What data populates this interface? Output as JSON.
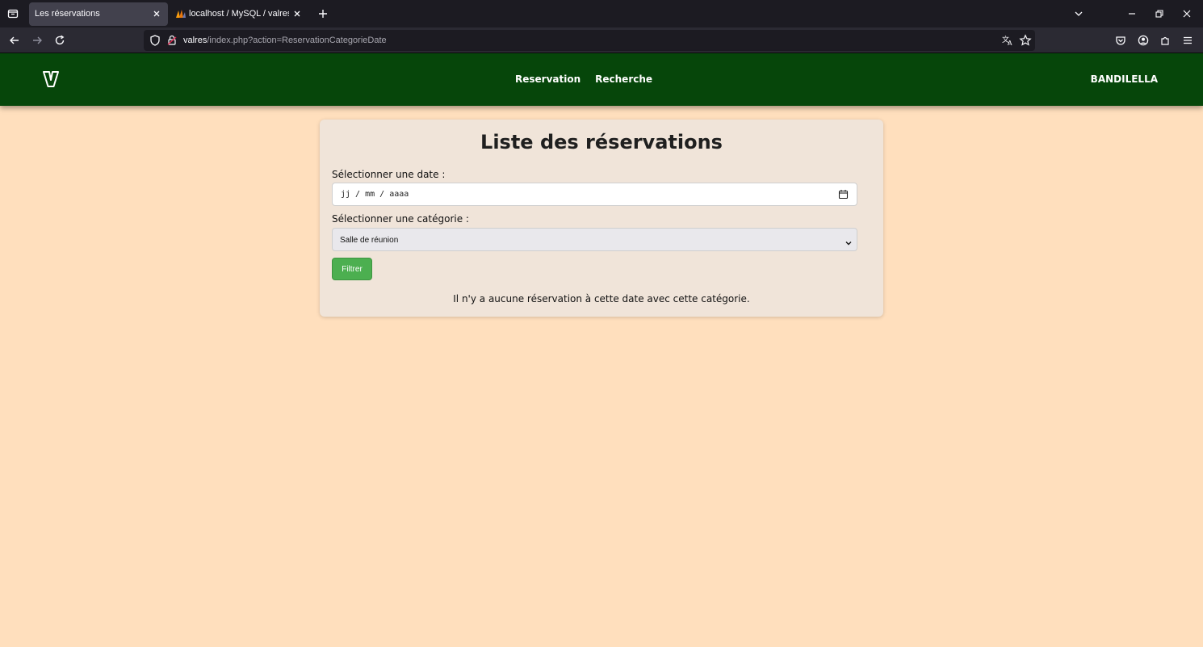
{
  "browser": {
    "tabs": [
      {
        "title": "Les réservations",
        "active": true
      },
      {
        "title": "localhost / MySQL / valres / utilisateur",
        "active": false
      }
    ],
    "url": {
      "host": "valres",
      "path": "/index.php?action=ReservationCategorieDate"
    }
  },
  "site": {
    "nav": [
      {
        "label": "Reservation"
      },
      {
        "label": "Recherche"
      }
    ],
    "user": "BANDILELLA"
  },
  "page": {
    "title": "Liste des réservations",
    "date_label": "Sélectionner une date :",
    "date_placeholder": "jj / mm / aaaa",
    "category_label": "Sélectionner une catégorie :",
    "category_value": "Salle de réunion",
    "filter_button": "Filtrer",
    "empty_message": "Il n'y a aucune réservation à cette date avec cette catégorie."
  },
  "colors": {
    "header": "#06460a",
    "background": "#ffdfbd",
    "card": "#f0e4d9",
    "button": "#4caf50"
  }
}
